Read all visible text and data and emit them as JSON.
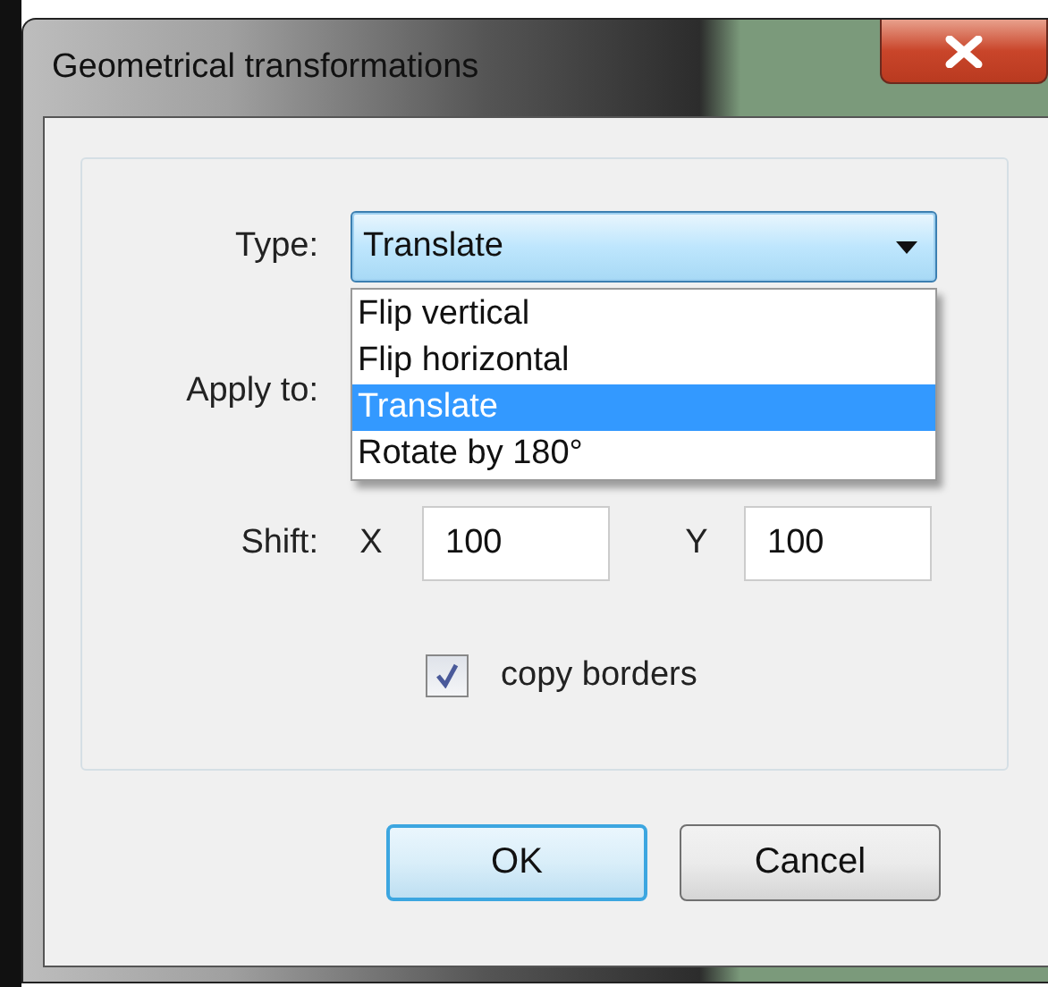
{
  "window": {
    "title": "Geometrical transformations"
  },
  "type_field": {
    "label": "Type:",
    "value": "Translate",
    "expanded": true,
    "options": [
      {
        "label": "Flip vertical",
        "selected": false
      },
      {
        "label": "Flip horizontal",
        "selected": false
      },
      {
        "label": "Translate",
        "selected": true
      },
      {
        "label": "Rotate by 180°",
        "selected": false
      }
    ]
  },
  "apply_to": {
    "label": "Apply to:"
  },
  "shift": {
    "label": "Shift:",
    "x_label": "X",
    "x_value": "100",
    "y_label": "Y",
    "y_value": "100"
  },
  "copy_borders": {
    "label": "copy borders",
    "checked": true
  },
  "buttons": [
    {
      "label": "OK",
      "default": true
    },
    {
      "label": "Cancel",
      "default": false
    }
  ]
}
